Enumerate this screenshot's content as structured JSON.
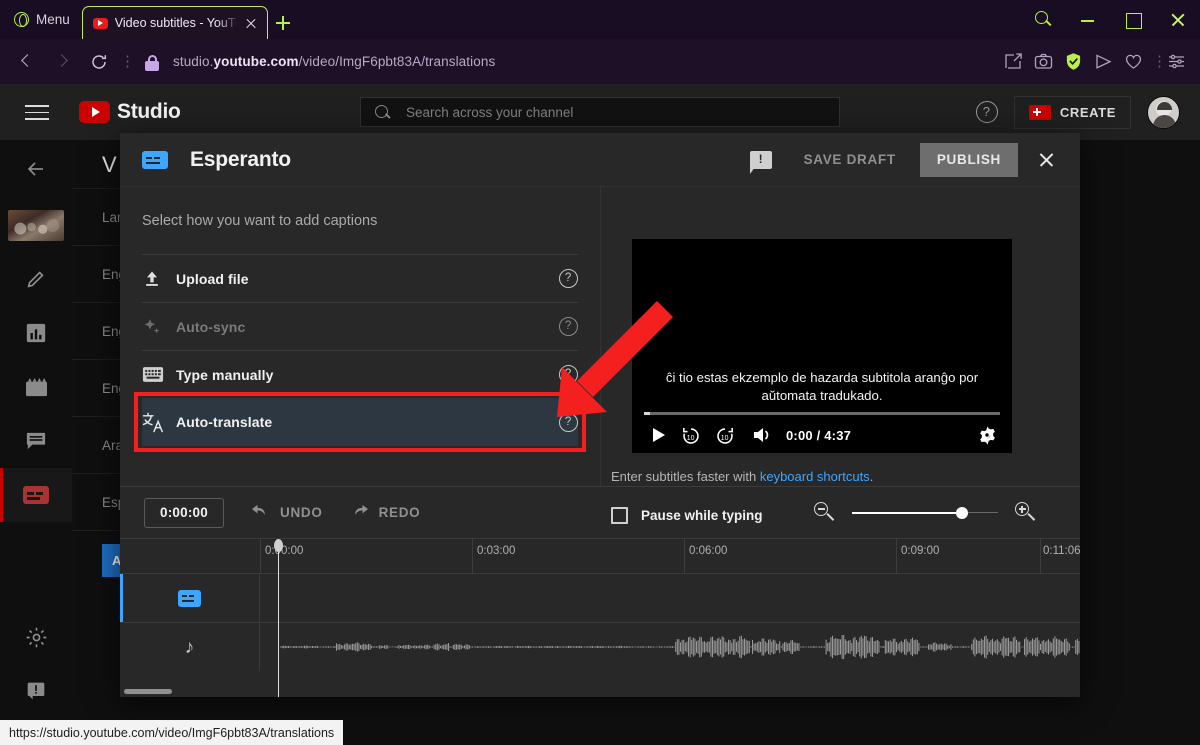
{
  "browser": {
    "menu_label": "Menu",
    "tab": {
      "title": "Video subtitles - YouTube S",
      "close_label": "×"
    },
    "address": {
      "url_host_prefix": "studio.",
      "url_host_bold": "youtube.com",
      "url_path": "/video/ImgF6pbt83A/translations"
    },
    "status_url": "https://studio.youtube.com/video/ImgF6pbt83A/translations"
  },
  "studio": {
    "logo_text": "Studio",
    "search_placeholder": "Search across your channel",
    "create_label": "CREATE",
    "background": {
      "page_title": "V",
      "rows": [
        {
          "label": "Lang"
        },
        {
          "label": "Engl"
        },
        {
          "label": "Engl"
        },
        {
          "label": "Engl"
        },
        {
          "label": "Aran"
        },
        {
          "label": "Espe"
        }
      ],
      "add_language_button": "A"
    }
  },
  "dialog": {
    "title": "Esperanto",
    "save_draft_label": "SAVE DRAFT",
    "publish_label": "PUBLISH",
    "section_heading": "Select how you want to add captions",
    "methods": [
      {
        "label": "Upload file",
        "icon": "upload-icon",
        "disabled": false,
        "selected": false
      },
      {
        "label": "Auto-sync",
        "icon": "sparkle-icon",
        "disabled": true,
        "selected": false
      },
      {
        "label": "Type manually",
        "icon": "keyboard-icon",
        "disabled": false,
        "selected": false
      },
      {
        "label": "Auto-translate",
        "icon": "auto-translate-icon",
        "disabled": false,
        "selected": true
      }
    ],
    "highlight_color": "#f41f1f",
    "selected_row_color": "#2c3742",
    "player": {
      "subtitle_text": "ĉi tio estas ekzemplo de hazarda subtitola aranĝo por aŭtomata tradukado.",
      "current_time": "0:00",
      "duration": "4:37",
      "time_display": "0:00 / 4:37"
    },
    "keyboard_hint": {
      "prefix": "Enter subtitles faster with ",
      "link": "keyboard shortcuts",
      "suffix": "."
    },
    "pause_while_typing_label": "Pause while typing",
    "toolbar": {
      "timecode": "0:00:00",
      "undo_label": "UNDO",
      "redo_label": "REDO"
    },
    "timeline": {
      "ruler_labels": [
        "0:00:00",
        "0:03:00",
        "0:06:00",
        "0:09:00",
        "0:11:06"
      ],
      "tracks": [
        {
          "name": "captions-track",
          "icon": "caption-icon"
        },
        {
          "name": "audio-track",
          "icon": "music-note-icon"
        }
      ]
    }
  }
}
